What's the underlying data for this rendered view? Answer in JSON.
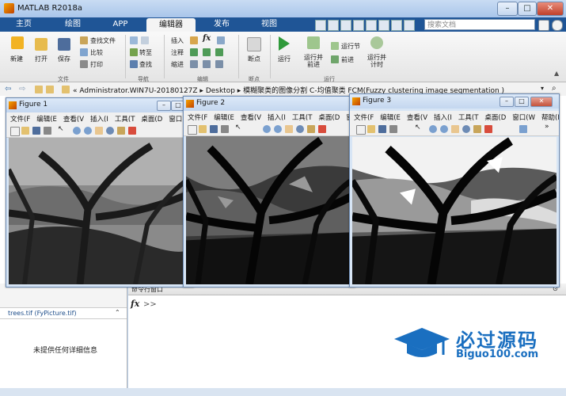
{
  "window": {
    "title": "MATLAB R2018a"
  },
  "tabs": [
    {
      "label": "主页"
    },
    {
      "label": "绘图"
    },
    {
      "label": "APP"
    },
    {
      "label": "编辑器"
    },
    {
      "label": "发布"
    },
    {
      "label": "视图"
    }
  ],
  "search": {
    "placeholder": "搜索文档"
  },
  "ribbon": {
    "new": "新建",
    "open": "打开",
    "save": "保存",
    "find_files": "查找文件",
    "compare": "比较",
    "print": "打印",
    "insert": "插入",
    "comment": "注释",
    "indent": "缩进",
    "goto": "转至",
    "find": "查找",
    "breakpoint": "断点",
    "run": "运行",
    "run_advance": "运行并\n前进",
    "run_section": "运行节",
    "advance": "前进",
    "run_time": "运行并\n计时",
    "group_file": "文件",
    "group_nav": "导航",
    "group_edit": "编辑",
    "group_bp": "断点",
    "group_run": "运行",
    "fx": "fx"
  },
  "address": {
    "path": "« Administrator.WIN7U-20180127Z  ▸  Desktop  ▸  模糊聚类的图像分割 C-均值聚类 FCM(Fuzzy clustering image segmentation )"
  },
  "figures": [
    {
      "title": "Figure 1",
      "menu": [
        "文件(F",
        "编辑(E",
        "查看(V",
        "插入(I",
        "工具(T",
        "桌面(D",
        "窗口(W"
      ]
    },
    {
      "title": "Figure 2",
      "menu": [
        "文件(F",
        "编辑(E",
        "查看(V",
        "插入(I",
        "工具(T",
        "桌面(D",
        "窗口(W"
      ]
    },
    {
      "title": "Figure 3",
      "menu": [
        "文件(F",
        "编辑(E",
        "查看(V",
        "插入(I",
        "工具(T",
        "桌面(D",
        "窗口(W",
        "帮助(H"
      ]
    }
  ],
  "left_panel": {
    "file_label": "trees.tif  (FyPicture.tif)",
    "details": "未提供任何详细信息"
  },
  "command_window": {
    "title": "命令行窗口",
    "prompt": ">>",
    "fx": "fx"
  },
  "watermark": {
    "brand": "必过源码",
    "url": "Biguo100.com"
  },
  "colors": {
    "tab_bar": "#1f5596",
    "accent": "#1a6fc0"
  }
}
